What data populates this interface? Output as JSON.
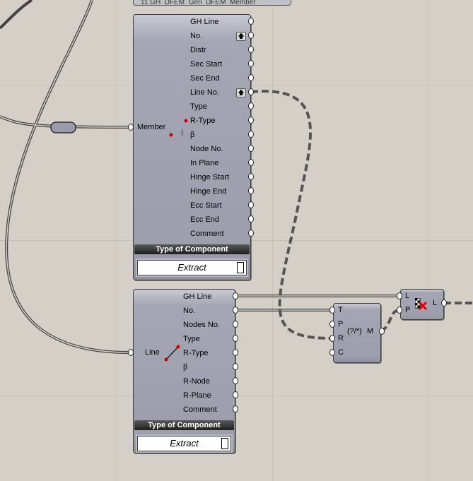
{
  "top_component": {
    "label": "11 GH_DFEM_Gen_DFEM_Member"
  },
  "member_component": {
    "input": "Member",
    "outputs": [
      "GH Line",
      "No.",
      "Distr",
      "Sec Start",
      "Sec End",
      "Line No.",
      "Type",
      "R-Type",
      "β",
      "Node No.",
      "In Plane",
      "Hinge Start",
      "Hinge End",
      "Ecc Start",
      "Ecc End",
      "Comment"
    ],
    "header": "Type of Component",
    "dropdown_value": "Extract"
  },
  "line_component": {
    "input": "Line",
    "outputs": [
      "GH Line",
      "No.",
      "Nodes No.",
      "Type",
      "R-Type",
      "β",
      "R-Node",
      "R-Plane",
      "Comment"
    ],
    "header": "Type of Component",
    "dropdown_value": "Extract"
  },
  "expression_component": {
    "inputs": [
      "T",
      "P",
      "R",
      "C"
    ],
    "label": "(?/*)",
    "output": "M"
  },
  "split_component": {
    "inputs": [
      "L",
      "P"
    ],
    "output": "L"
  },
  "colors": {
    "canvas": "#d4d0c8",
    "component": "#a5a5b4",
    "wire": "#555555",
    "node_red": "#cc0000"
  }
}
